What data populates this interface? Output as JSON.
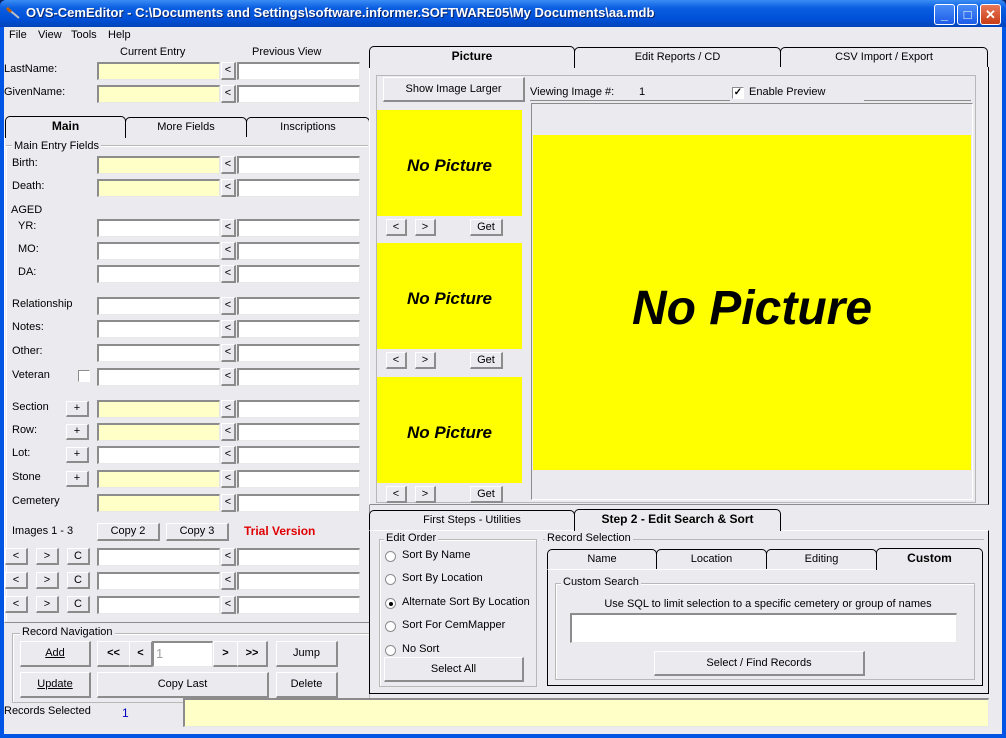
{
  "window": {
    "title": "OVS-CemEditor  - C:\\Documents and Settings\\software.informer.SOFTWARE05\\My Documents\\aa.mdb",
    "minimize": "_",
    "maximize": "□",
    "close": "✕"
  },
  "menu": [
    "File",
    "View",
    "Tools",
    "Help"
  ],
  "columns": {
    "current": "Current Entry",
    "previous": "Previous View"
  },
  "name_fields": [
    {
      "label": "LastName:",
      "value": "",
      "previous": ""
    },
    {
      "label": "GivenName:",
      "value": "",
      "previous": ""
    }
  ],
  "left_tabs": [
    {
      "label": "Main",
      "active": true
    },
    {
      "label": "More Fields",
      "active": false
    },
    {
      "label": "Inscriptions",
      "active": false
    }
  ],
  "main_entry": {
    "group_title": "Main Entry Fields",
    "birth_label": "Birth:",
    "death_label": "Death:",
    "aged_label": "AGED",
    "yr_label": "YR:",
    "mo_label": "MO:",
    "da_label": "DA:",
    "relationship_label": "Relationship",
    "notes_label": "Notes:",
    "other_label": "Other:",
    "veteran_label": "Veteran",
    "veteran_checked": false,
    "section_label": "Section",
    "row_label": "Row:",
    "lot_label": "Lot:",
    "stone_label": "Stone",
    "cemetery_label": "Cemetery",
    "copy_arrow": "<",
    "plus": "+"
  },
  "images": {
    "label": "Images 1 - 3",
    "copy2": "Copy 2",
    "copy3": "Copy 3",
    "trial": "Trial Version",
    "prev": "<",
    "next": ">",
    "clear": "C"
  },
  "record_nav": {
    "title": "Record Navigation",
    "add": "Add",
    "first": "<<",
    "prev": "<",
    "record_number": "1",
    "next": ">",
    "last": ">>",
    "jump": "Jump",
    "update": "Update",
    "copy_last": "Copy Last",
    "delete": "Delete"
  },
  "status": {
    "records_selected_label": "Records Selected",
    "records_selected_value": "1",
    "message": ""
  },
  "right_tabs": [
    {
      "label": "Picture",
      "active": true
    },
    {
      "label": "Edit Reports / CD",
      "active": false
    },
    {
      "label": "CSV Import / Export",
      "active": false
    }
  ],
  "picture": {
    "show_larger": "Show Image Larger",
    "viewing_label": "Viewing Image #:",
    "viewing_value": "1",
    "enable_preview": "Enable Preview",
    "enable_preview_checked": true,
    "no_picture": "No Picture",
    "get": "Get",
    "prev": "<",
    "next": ">"
  },
  "bottom_tabs": [
    {
      "label": "First Steps - Utilities",
      "active": false
    },
    {
      "label": "Step 2 - Edit Search & Sort",
      "active": true
    }
  ],
  "edit_order": {
    "title": "Edit Order",
    "options": [
      {
        "label": "Sort By Name",
        "selected": false
      },
      {
        "label": "Sort By Location",
        "selected": false
      },
      {
        "label": "Alternate Sort By Location",
        "selected": true
      },
      {
        "label": "Sort For CemMapper",
        "selected": false
      },
      {
        "label": "No Sort",
        "selected": false
      }
    ],
    "select_all": "Select All"
  },
  "record_selection": {
    "title": "Record Selection",
    "tabs": [
      {
        "label": "Name",
        "active": false
      },
      {
        "label": "Location",
        "active": false
      },
      {
        "label": "Editing",
        "active": false
      },
      {
        "label": "Custom",
        "active": true
      }
    ],
    "custom_title": "Custom Search",
    "custom_hint": "Use SQL to limit selection to a specific cemetery or group of names",
    "sql_value": "",
    "find_button": "Select / Find Records"
  },
  "colors": {
    "field_yellow": "#ffffc8",
    "picture_yellow": "#ffff00",
    "trial_red": "#e00000",
    "count_blue": "#0000c0"
  }
}
